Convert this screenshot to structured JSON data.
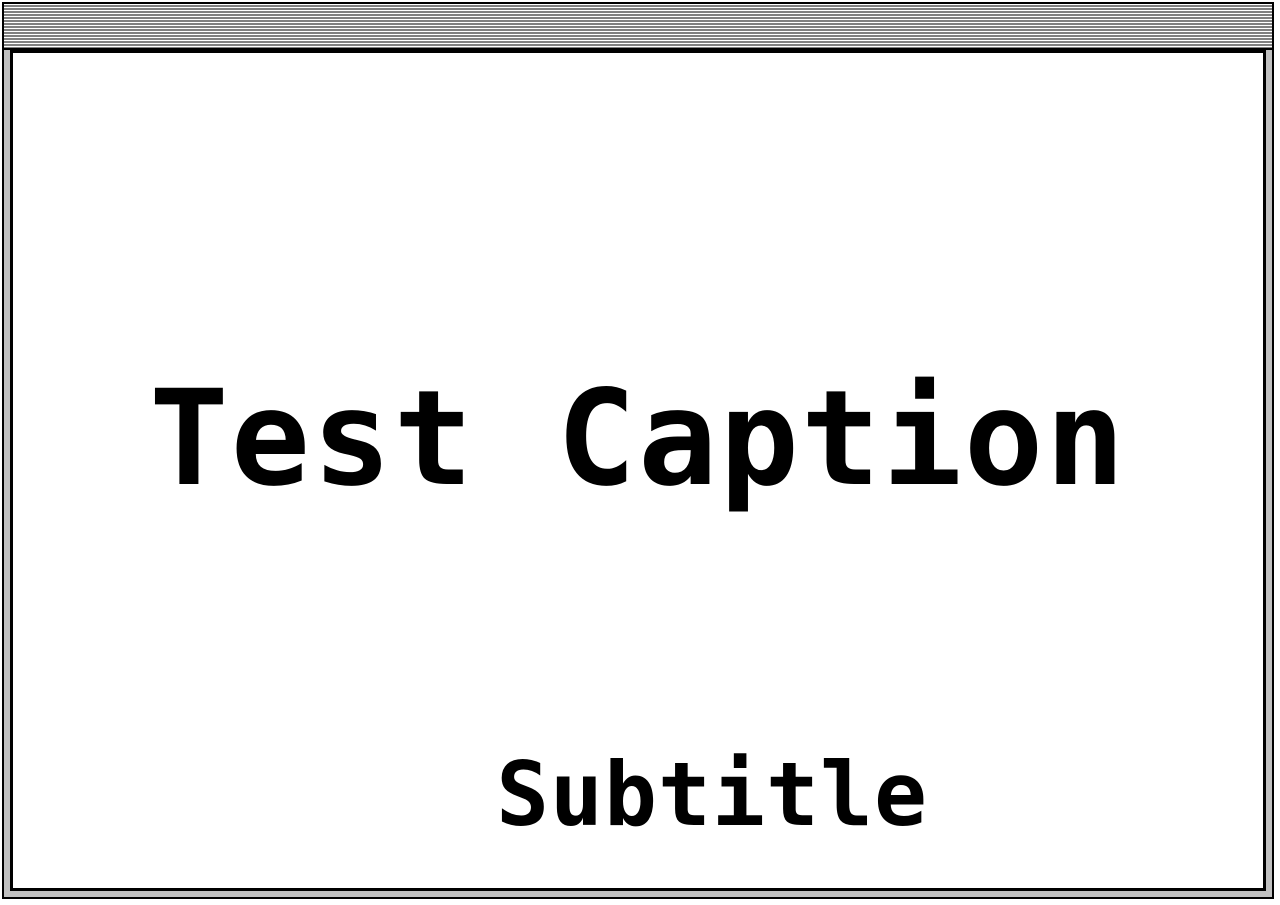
{
  "window": {
    "caption": "Test Caption",
    "subtitle": "Subtitle"
  },
  "colors": {
    "background": "#ffffff",
    "text": "#000000",
    "frame": "#000000",
    "titlebar_stripe": "#808080"
  }
}
